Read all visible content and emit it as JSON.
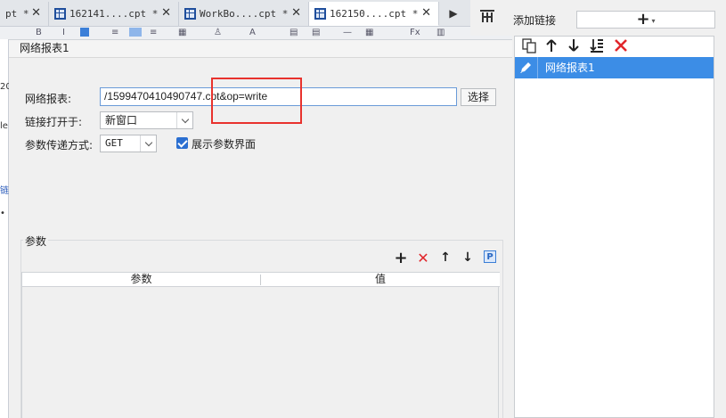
{
  "tabs": [
    {
      "title": "pt *",
      "active": false
    },
    {
      "title": "162141....cpt *",
      "active": false
    },
    {
      "title": "WorkBo....cpt *",
      "active": false
    },
    {
      "title": "162150....cpt *",
      "active": true
    }
  ],
  "dialog": {
    "title": "网络报表1",
    "url_label": "网络报表:",
    "url_value": "/1599470410490747.cpt&op=write",
    "choose_button": "选择",
    "open_in_label": "链接打开于:",
    "open_in_value": "新窗口",
    "method_label": "参数传递方式:",
    "method_value": "GET",
    "show_params_label": "展示参数界面",
    "show_params_checked": true,
    "params_section_title": "参数",
    "params_table": {
      "columns": [
        "参数",
        "值"
      ],
      "rows": []
    },
    "params_toolbar": {
      "add_glyph": "+",
      "delete_glyph": "✕",
      "up_glyph": "↑",
      "down_glyph": "↓",
      "p_glyph": "P"
    }
  },
  "right_panel": {
    "add_link_label": "添加链接",
    "add_glyph": "+",
    "add_caret": "▾",
    "list_items": [
      {
        "label": "网络报表1",
        "selected": true
      }
    ]
  },
  "colors": {
    "selected_blue": "#3c8de6",
    "highlight_red": "#e8322d",
    "delete_red": "#e1262b"
  }
}
